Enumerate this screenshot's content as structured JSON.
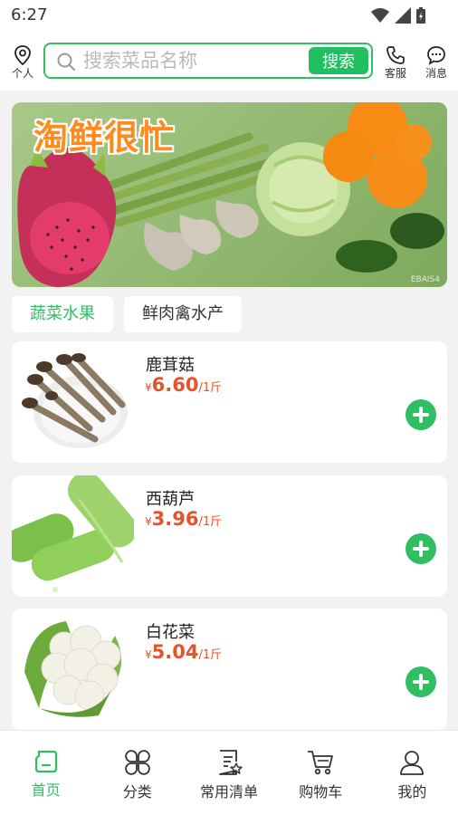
{
  "status_bar": {
    "time": "6:27"
  },
  "header": {
    "personal_label": "个人",
    "search_placeholder": "搜索菜品名称",
    "search_button": "搜索",
    "service_label": "客服",
    "message_label": "消息"
  },
  "banner": {
    "title": "淘鲜很忙",
    "watermark": "EBAIS4"
  },
  "category_tabs": [
    {
      "label": "蔬菜水果",
      "active": true
    },
    {
      "label": "鲜肉禽水产",
      "active": false
    }
  ],
  "products": [
    {
      "name": "鹿茸菇",
      "currency": "¥",
      "price": "6.60",
      "unit": "/1斤",
      "image": "mushroom"
    },
    {
      "name": "西葫芦",
      "currency": "¥",
      "price": "3.96",
      "unit": "/1斤",
      "image": "zucchini"
    },
    {
      "name": "白花菜",
      "currency": "¥",
      "price": "5.04",
      "unit": "/1斤",
      "image": "cauliflower"
    }
  ],
  "bottom_nav": [
    {
      "label": "首页",
      "icon": "home-icon",
      "active": true
    },
    {
      "label": "分类",
      "icon": "category-icon",
      "active": false
    },
    {
      "label": "常用清单",
      "icon": "list-icon",
      "active": false
    },
    {
      "label": "购物车",
      "icon": "cart-icon",
      "active": false
    },
    {
      "label": "我的",
      "icon": "user-icon",
      "active": false
    }
  ],
  "colors": {
    "accent": "#2fbf62",
    "price": "#e5532c",
    "banner_title": "#ff8a1e"
  }
}
